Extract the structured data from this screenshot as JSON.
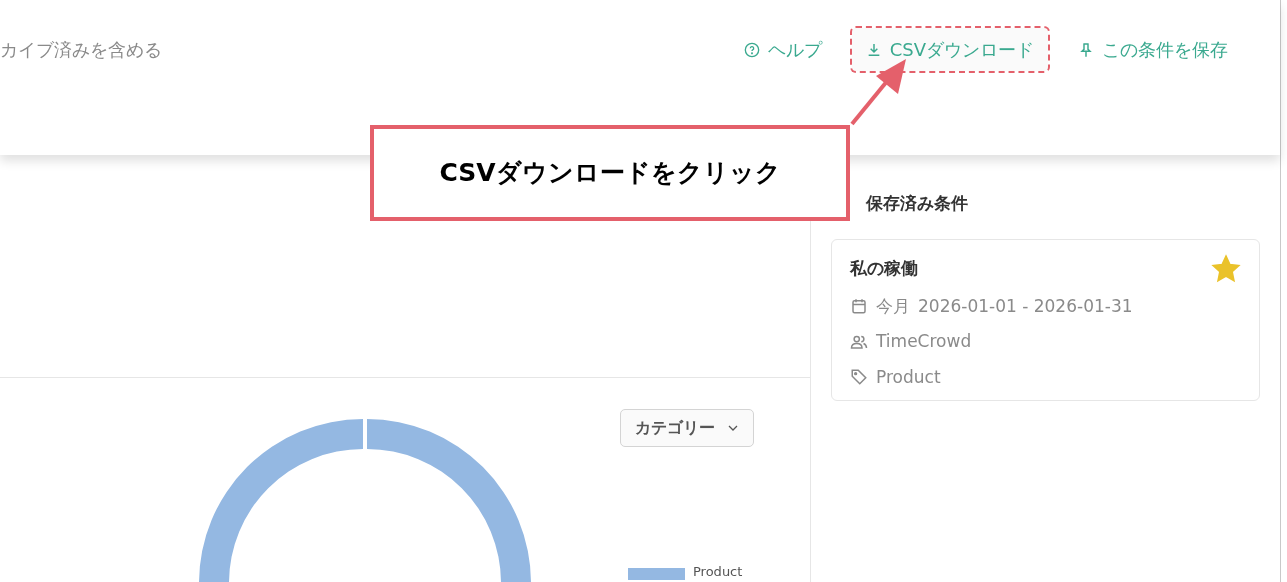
{
  "header": {
    "archive_toggle_label": "カイブ済みを含める",
    "actions": [
      {
        "kind": "help",
        "label": "ヘルプ",
        "highlighted": false
      },
      {
        "kind": "download",
        "label": "CSVダウンロード",
        "highlighted": true
      },
      {
        "kind": "pin",
        "label": "この条件を保存",
        "highlighted": false
      }
    ]
  },
  "callout": {
    "text": "CSVダウンロードをクリック"
  },
  "chart_panel": {
    "group_select": {
      "value": "カテゴリー"
    },
    "legend": [
      {
        "label": "Product",
        "color": "#94b8e2"
      }
    ]
  },
  "saved_conditions": {
    "title": "保存済み条件",
    "items": [
      {
        "name": "私の稼働",
        "starred": true,
        "period": "今月",
        "date_range": "2026-01-01 - 2026-01-31",
        "team": "TimeCrowd",
        "tag": "Product"
      }
    ]
  }
}
